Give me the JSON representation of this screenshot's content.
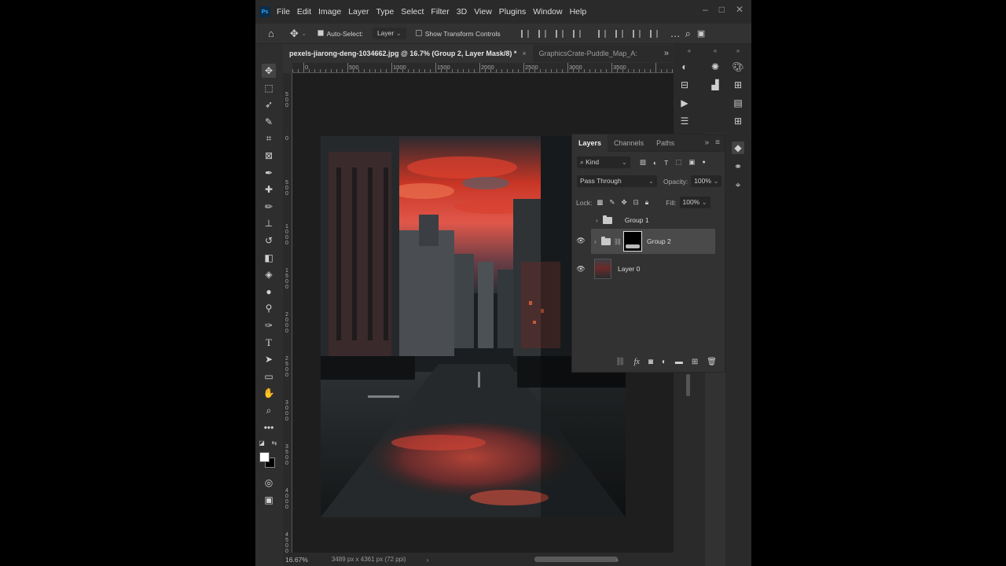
{
  "app": {
    "logo": "Ps",
    "menus": [
      "File",
      "Edit",
      "Image",
      "Layer",
      "Type",
      "Select",
      "Filter",
      "3D",
      "View",
      "Plugins",
      "Window",
      "Help"
    ]
  },
  "options_bar": {
    "auto_select_label": "Auto-Select:",
    "auto_select_value": "Layer",
    "transform_label": "Show Transform Controls"
  },
  "tabs": [
    {
      "label": "pexels-jiarong-deng-1034662.jpg @ 16.7% (Group 2, Layer Mask/8) *",
      "close": "×"
    },
    {
      "label": "GraphicsCrate-Puddle_Map_A:"
    }
  ],
  "ruler": {
    "top_labels": [
      "0",
      "500",
      "1000",
      "1500",
      "2000",
      "2500",
      "3000",
      "3500"
    ],
    "left_labels": [
      "5\n0\n0",
      "0",
      "5\n0\n0",
      "1\n0\n0\n0",
      "1\n5\n0\n0",
      "2\n0\n0\n0",
      "2\n5\n0\n0",
      "3\n0\n0\n0",
      "3\n5\n0\n0",
      "4\n0\n0\n0",
      "4\n5\n0\n0"
    ]
  },
  "status": {
    "zoom": "16.67%",
    "doc_info": "3489 px x 4361 px (72 ppi)"
  },
  "layers_panel": {
    "tabs": [
      "Layers",
      "Channels",
      "Paths"
    ],
    "filter_kind": "Kind",
    "blend_mode": "Pass Through",
    "opacity_label": "Opacity:",
    "opacity_value": "100%",
    "lock_label": "Lock:",
    "fill_label": "Fill:",
    "fill_value": "100%",
    "layers": [
      {
        "name": "Group 1",
        "visible": false
      },
      {
        "name": "Group 2",
        "visible": true,
        "selected": true
      },
      {
        "name": "Layer 0",
        "visible": true
      }
    ]
  },
  "colors": {
    "ui_background": "#323232",
    "menu_bar": "#2a2a2a",
    "selected_layer": "#4a4a4a",
    "sky_red": "#d63a2a"
  }
}
